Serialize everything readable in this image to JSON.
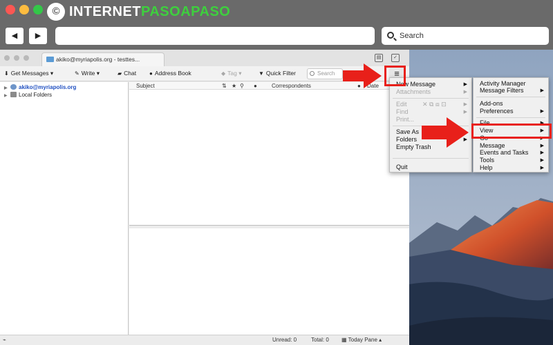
{
  "brand": {
    "text_left": "INTERNET",
    "text_right": "PASOAPASO",
    "logo_glyph": "©",
    "accent_color": "#3ecf3e"
  },
  "browser": {
    "back_icon": "◀",
    "forward_icon": "▶",
    "url_value": "",
    "search_placeholder": "Search"
  },
  "thunderbird": {
    "tab_title": "akiko@myriapolis.org - testtes...",
    "toolbar": {
      "get_messages": "Get Messages",
      "write": "Write",
      "chat": "Chat",
      "address_book": "Address Book",
      "tag": "Tag",
      "quick_filter": "Quick Filter",
      "search_placeholder": "Search"
    },
    "menu_icon": "≡",
    "folders": [
      {
        "label": "akiko@myriapolis.org"
      },
      {
        "label": "Local Folders"
      }
    ],
    "columns": {
      "subject": "Subject",
      "correspondents": "Correspondents",
      "date": "Date"
    },
    "status": {
      "unread": "Unread: 0",
      "total": "Total: 0",
      "today_pane": "Today Pane"
    }
  },
  "app_menu": {
    "new_message": "New Message",
    "attachments": "Attachments",
    "edit": "Edit",
    "find": "Find",
    "print": "Print...",
    "save_as": "Save As",
    "folders": "Folders",
    "empty_trash": "Empty Trash",
    "quit": "Quit"
  },
  "submenu": {
    "activity_manager": "Activity Manager",
    "message_filters": "Message Filters",
    "add_ons": "Add-ons",
    "preferences": "Preferences",
    "file": "File",
    "view": "View",
    "go": "Go",
    "message": "Message",
    "events_and_tasks": "Events and Tasks",
    "tools": "Tools",
    "help": "Help"
  },
  "colors": {
    "highlight_red": "#e8201a",
    "chrome_gray": "#6a6a6a"
  }
}
